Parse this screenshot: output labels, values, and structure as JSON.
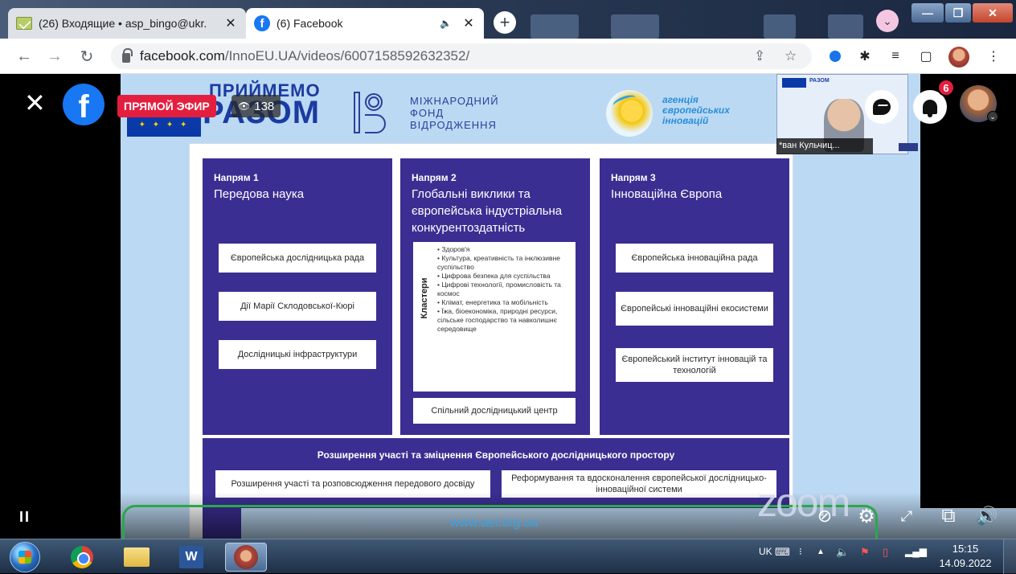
{
  "browser": {
    "tabs": [
      {
        "title": "(26) Входящие • asp_bingo@ukr.",
        "icon": "mail-icon"
      },
      {
        "title": "(6) Facebook",
        "icon": "facebook-icon",
        "audio": "🔈"
      }
    ],
    "close_glyph": "✕",
    "new_tab_glyph": "+",
    "url_host": "facebook.com",
    "url_path": "/InnoEU.UA/videos/6007158592632352/",
    "window_controls": {
      "minimize": "—",
      "maximize": "❐",
      "close": "✕"
    }
  },
  "video": {
    "live_label": "ПРЯМОЙ ЭФИР",
    "viewer_count": "138",
    "notifications_count": "6",
    "host_name": "*ван Кульчиц...",
    "zoom_watermark": "zoom",
    "footer_url": "www.aei.org.ua",
    "controls": {
      "pause": "II"
    }
  },
  "slide": {
    "eu_flag_stars": "✦ ✦ ✦ ✦",
    "razom_line1": "ПРИЙМЕМО",
    "razom_line2": "РАЗОМ",
    "mfv_line1": "МІЖНАРОДНИЙ",
    "mfv_line2": "ФОНД",
    "mfv_line3": "ВІДРОДЖЕННЯ",
    "agency_line1": "агенція",
    "agency_line2": "європейських",
    "agency_line3": "інновацій",
    "host_mini_logo": "РАЗОМ",
    "pillars": [
      {
        "head": "Напрям 1",
        "title": "Передова наука",
        "items": [
          "Європейська дослідницька рада",
          "Дії Марії Склодовської-Кюрі",
          "Дослідницькі інфраструктури"
        ]
      },
      {
        "head": "Напрям 2",
        "title": "Глобальні виклики та європейська індустріальна конкурентоздатність",
        "cluster_label": "Кластери",
        "clusters": [
          "Здоров'я",
          "Культура, креативність та інклюзивне суспільство",
          "Цифрова безпека для суспільства",
          "Цифрові технології, промисловість та космос",
          "Клімат, енергетика та мобільність",
          "Їжа, біоекономіка, природні ресурси, сільське господарство та навколишнє середовище"
        ],
        "bottom_box": "Спільний дослідницький центр"
      },
      {
        "head": "Напрям 3",
        "title": "Інноваційна Європа",
        "items": [
          "Європейська інноваційна рада",
          "Європейські інноваційні екосистеми",
          "Європейський інститут інновацій та технологій"
        ]
      }
    ],
    "bottom_title": "Розширення участі та зміцнення Європейського дослідницького простору",
    "bottom_items": [
      "Розширення участі та розповсюдження передового досвіду",
      "Реформування та вдосконалення європейської дослідницько-інноваційної системи"
    ]
  },
  "taskbar": {
    "language": "UK",
    "time": "15:15",
    "date": "14.09.2022"
  }
}
